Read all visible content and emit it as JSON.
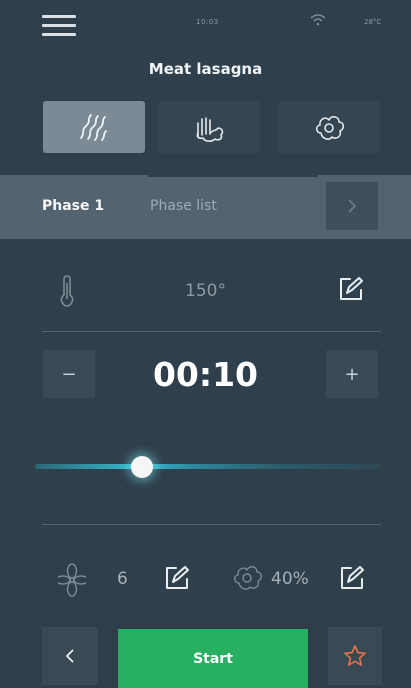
{
  "status_bar": {
    "time": "10:03",
    "temperature": "28°C"
  },
  "recipe": {
    "title": "Meat lasagna"
  },
  "modes": [
    {
      "name": "convection",
      "icon": "heat-waves-icon",
      "active": true
    },
    {
      "name": "steam-convection",
      "icon": "hand-cloud-icon",
      "active": false
    },
    {
      "name": "steam",
      "icon": "cloud-icon",
      "active": false
    }
  ],
  "phase": {
    "current": "Phase 1",
    "list_label": "Phase list"
  },
  "temperature": {
    "value": "150°"
  },
  "timer": {
    "value": "00:10",
    "minus": "−",
    "plus": "+"
  },
  "slider": {
    "position_fraction": 0.31
  },
  "fan": {
    "value": "6"
  },
  "humidity": {
    "value": "40%"
  },
  "footer": {
    "start_label": "Start"
  },
  "colors": {
    "accent_green": "#27b062",
    "star": "#e5734f",
    "slider_glow": "#37bcd0",
    "background": "#2f3f4c"
  }
}
